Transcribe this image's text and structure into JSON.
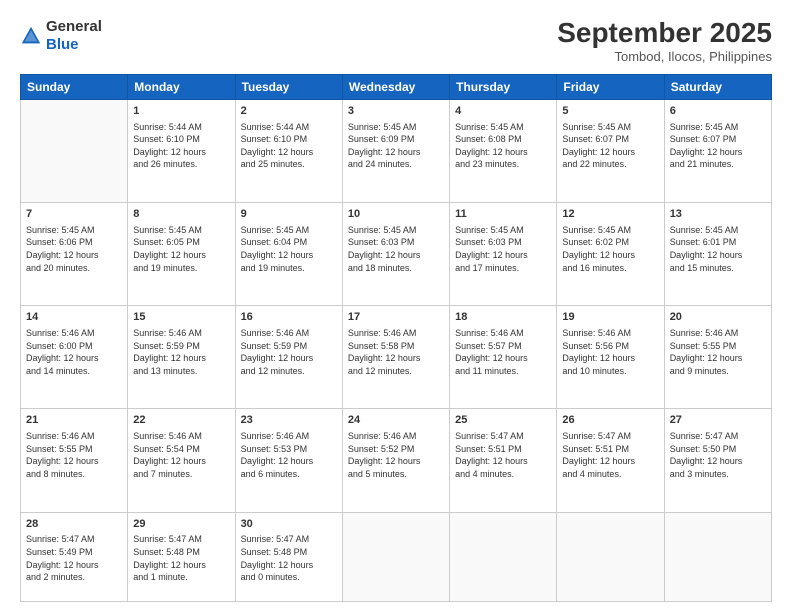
{
  "header": {
    "logo_line1": "General",
    "logo_line2": "Blue",
    "month": "September 2025",
    "location": "Tombod, Ilocos, Philippines"
  },
  "weekdays": [
    "Sunday",
    "Monday",
    "Tuesday",
    "Wednesday",
    "Thursday",
    "Friday",
    "Saturday"
  ],
  "weeks": [
    [
      {
        "day": "",
        "info": ""
      },
      {
        "day": "1",
        "info": "Sunrise: 5:44 AM\nSunset: 6:10 PM\nDaylight: 12 hours\nand 26 minutes."
      },
      {
        "day": "2",
        "info": "Sunrise: 5:44 AM\nSunset: 6:10 PM\nDaylight: 12 hours\nand 25 minutes."
      },
      {
        "day": "3",
        "info": "Sunrise: 5:45 AM\nSunset: 6:09 PM\nDaylight: 12 hours\nand 24 minutes."
      },
      {
        "day": "4",
        "info": "Sunrise: 5:45 AM\nSunset: 6:08 PM\nDaylight: 12 hours\nand 23 minutes."
      },
      {
        "day": "5",
        "info": "Sunrise: 5:45 AM\nSunset: 6:07 PM\nDaylight: 12 hours\nand 22 minutes."
      },
      {
        "day": "6",
        "info": "Sunrise: 5:45 AM\nSunset: 6:07 PM\nDaylight: 12 hours\nand 21 minutes."
      }
    ],
    [
      {
        "day": "7",
        "info": "Sunrise: 5:45 AM\nSunset: 6:06 PM\nDaylight: 12 hours\nand 20 minutes."
      },
      {
        "day": "8",
        "info": "Sunrise: 5:45 AM\nSunset: 6:05 PM\nDaylight: 12 hours\nand 19 minutes."
      },
      {
        "day": "9",
        "info": "Sunrise: 5:45 AM\nSunset: 6:04 PM\nDaylight: 12 hours\nand 19 minutes."
      },
      {
        "day": "10",
        "info": "Sunrise: 5:45 AM\nSunset: 6:03 PM\nDaylight: 12 hours\nand 18 minutes."
      },
      {
        "day": "11",
        "info": "Sunrise: 5:45 AM\nSunset: 6:03 PM\nDaylight: 12 hours\nand 17 minutes."
      },
      {
        "day": "12",
        "info": "Sunrise: 5:45 AM\nSunset: 6:02 PM\nDaylight: 12 hours\nand 16 minutes."
      },
      {
        "day": "13",
        "info": "Sunrise: 5:45 AM\nSunset: 6:01 PM\nDaylight: 12 hours\nand 15 minutes."
      }
    ],
    [
      {
        "day": "14",
        "info": "Sunrise: 5:46 AM\nSunset: 6:00 PM\nDaylight: 12 hours\nand 14 minutes."
      },
      {
        "day": "15",
        "info": "Sunrise: 5:46 AM\nSunset: 5:59 PM\nDaylight: 12 hours\nand 13 minutes."
      },
      {
        "day": "16",
        "info": "Sunrise: 5:46 AM\nSunset: 5:59 PM\nDaylight: 12 hours\nand 12 minutes."
      },
      {
        "day": "17",
        "info": "Sunrise: 5:46 AM\nSunset: 5:58 PM\nDaylight: 12 hours\nand 12 minutes."
      },
      {
        "day": "18",
        "info": "Sunrise: 5:46 AM\nSunset: 5:57 PM\nDaylight: 12 hours\nand 11 minutes."
      },
      {
        "day": "19",
        "info": "Sunrise: 5:46 AM\nSunset: 5:56 PM\nDaylight: 12 hours\nand 10 minutes."
      },
      {
        "day": "20",
        "info": "Sunrise: 5:46 AM\nSunset: 5:55 PM\nDaylight: 12 hours\nand 9 minutes."
      }
    ],
    [
      {
        "day": "21",
        "info": "Sunrise: 5:46 AM\nSunset: 5:55 PM\nDaylight: 12 hours\nand 8 minutes."
      },
      {
        "day": "22",
        "info": "Sunrise: 5:46 AM\nSunset: 5:54 PM\nDaylight: 12 hours\nand 7 minutes."
      },
      {
        "day": "23",
        "info": "Sunrise: 5:46 AM\nSunset: 5:53 PM\nDaylight: 12 hours\nand 6 minutes."
      },
      {
        "day": "24",
        "info": "Sunrise: 5:46 AM\nSunset: 5:52 PM\nDaylight: 12 hours\nand 5 minutes."
      },
      {
        "day": "25",
        "info": "Sunrise: 5:47 AM\nSunset: 5:51 PM\nDaylight: 12 hours\nand 4 minutes."
      },
      {
        "day": "26",
        "info": "Sunrise: 5:47 AM\nSunset: 5:51 PM\nDaylight: 12 hours\nand 4 minutes."
      },
      {
        "day": "27",
        "info": "Sunrise: 5:47 AM\nSunset: 5:50 PM\nDaylight: 12 hours\nand 3 minutes."
      }
    ],
    [
      {
        "day": "28",
        "info": "Sunrise: 5:47 AM\nSunset: 5:49 PM\nDaylight: 12 hours\nand 2 minutes."
      },
      {
        "day": "29",
        "info": "Sunrise: 5:47 AM\nSunset: 5:48 PM\nDaylight: 12 hours\nand 1 minute."
      },
      {
        "day": "30",
        "info": "Sunrise: 5:47 AM\nSunset: 5:48 PM\nDaylight: 12 hours\nand 0 minutes."
      },
      {
        "day": "",
        "info": ""
      },
      {
        "day": "",
        "info": ""
      },
      {
        "day": "",
        "info": ""
      },
      {
        "day": "",
        "info": ""
      }
    ]
  ]
}
